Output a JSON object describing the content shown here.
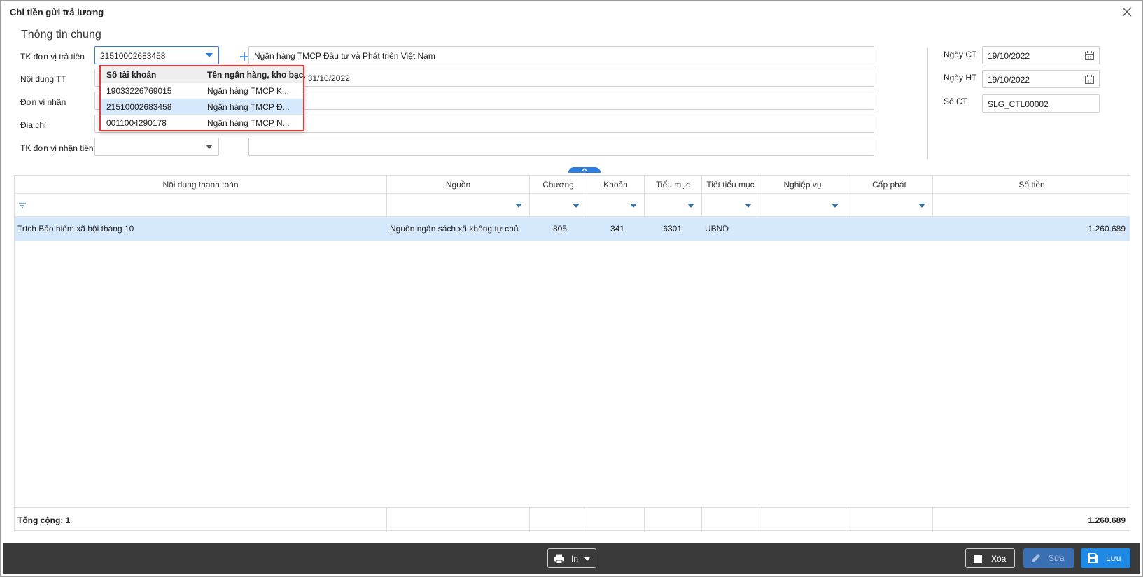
{
  "window": {
    "title": "Chi tiền gửi trả lương"
  },
  "section": {
    "title": "Thông tin chung"
  },
  "form": {
    "payer_account_label": "TK đơn vị trả tiền",
    "payer_account_value": "21510002683458",
    "payer_bank_name": "Ngân hàng TMCP Đầu tư và Phát triển Việt Nam",
    "payment_content_label": "Nội dung TT",
    "payment_content_value": "gày 31/10/2022.",
    "receiver_label": "Đơn vị nhận",
    "receiver_value": "",
    "address_label": "Địa chỉ",
    "address_value": "",
    "receiver_account_label": "TK đơn vị nhận tiền",
    "receiver_account_value": "",
    "receiver_bank_value": ""
  },
  "right_panel": {
    "voucher_date_label": "Ngày CT",
    "voucher_date_value": "19/10/2022",
    "posting_date_label": "Ngày HT",
    "posting_date_value": "19/10/2022",
    "voucher_no_label": "Số CT",
    "voucher_no_value": "SLG_CTL00002"
  },
  "dropdown": {
    "headers": [
      "Số tài khoản",
      "Tên ngân hàng, kho bạc"
    ],
    "rows": [
      {
        "account": "19033226769015",
        "bank": "Ngân hàng TMCP K..."
      },
      {
        "account": "21510002683458",
        "bank": "Ngân hàng TMCP Đ..."
      },
      {
        "account": "0011004290178",
        "bank": "Ngân hàng TMCP N..."
      }
    ],
    "selected_index": 1
  },
  "grid": {
    "columns": [
      "Nội dung thanh toán",
      "Nguồn",
      "Chương",
      "Khoản",
      "Tiểu mục",
      "Tiết tiểu mục",
      "Nghiệp vụ",
      "Cấp phát",
      "Số tiền"
    ],
    "rows": [
      {
        "content": "Trích Bảo hiểm xã hội tháng 10",
        "source": "Nguồn ngân sách xã không tự chủ",
        "chapter": "805",
        "item": "341",
        "sub_item": "6301",
        "detail": "UBND",
        "business": "",
        "allocation": "",
        "amount": "1.260.689"
      }
    ],
    "footer_label": "Tổng cộng: 1",
    "footer_total": "1.260.689"
  },
  "toolbar": {
    "print_label": "In",
    "delete_label": "Xóa",
    "edit_label": "Sửa",
    "save_label": "Lưu"
  },
  "colors": {
    "accent": "#2a7de1",
    "selected_row": "#d6e8fb",
    "toolbar_bg": "#3a3a3a",
    "highlight_border": "#e53935"
  }
}
